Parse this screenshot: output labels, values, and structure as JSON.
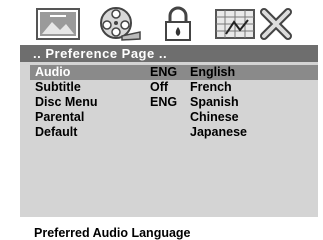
{
  "icons": [
    "monitor-icon",
    "film-reel-icon",
    "padlock-icon",
    "grid-picture-icon",
    "close-icon"
  ],
  "panel": {
    "title": ".. Preference  Page  .."
  },
  "menu": [
    {
      "label": "Audio",
      "value": "ENG"
    },
    {
      "label": "Subtitle",
      "value": "Off"
    },
    {
      "label": "Disc  Menu",
      "value": "ENG"
    },
    {
      "label": "Parental",
      "value": ""
    },
    {
      "label": "Default",
      "value": ""
    }
  ],
  "options": [
    "English",
    "French",
    "Spanish",
    "Chinese",
    "Japanese"
  ],
  "status": "Preferred  Audio  Language",
  "colors": {
    "panel": "#d4d4d4",
    "header": "#6e6e6e",
    "highlight": "#8a8a8a"
  }
}
